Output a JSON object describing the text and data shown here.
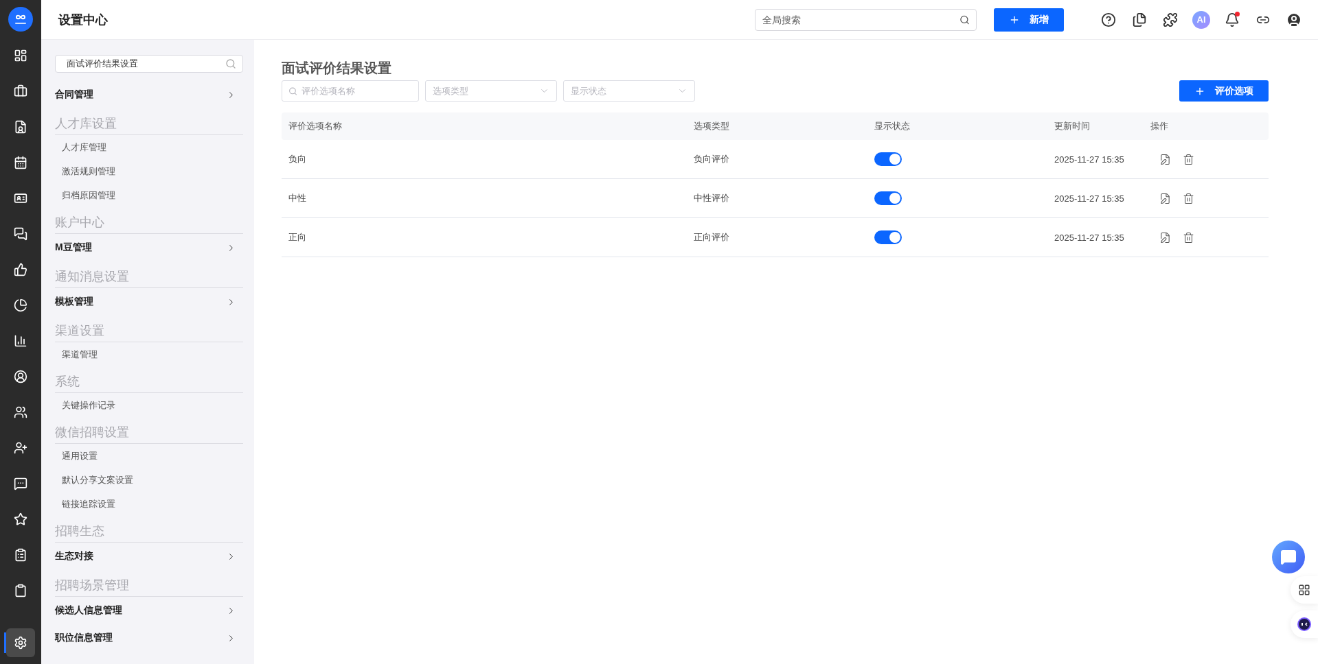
{
  "app": {
    "title": "设置中心"
  },
  "nav_rail": [
    {
      "selected": false
    },
    {
      "selected": false
    },
    {
      "selected": false
    },
    {
      "selected": false
    },
    {
      "selected": false
    },
    {
      "selected": false
    },
    {
      "selected": false
    },
    {
      "selected": false
    },
    {
      "selected": false
    },
    {
      "selected": false
    },
    {
      "selected": false
    },
    {
      "selected": false
    },
    {
      "selected": false
    },
    {
      "selected": false
    },
    {
      "selected": false
    },
    {
      "selected": false
    },
    {
      "selected": true
    }
  ],
  "top_bar": {
    "search": {
      "placeholder": "全局搜索"
    },
    "add_button": "新增",
    "ai_label": "AI",
    "notification_unread": true
  },
  "sidebar": {
    "search": {
      "value": "面试评价结果设置"
    },
    "sections": [
      {
        "items": [
          {
            "label": "合同管理",
            "kind": "link"
          }
        ]
      },
      {
        "heading": "人才库设置",
        "items": [
          {
            "label": "人才库管理",
            "kind": "sub"
          },
          {
            "label": "激活规则管理",
            "kind": "sub"
          },
          {
            "label": "归档原因管理",
            "kind": "sub"
          }
        ]
      },
      {
        "heading": "账户中心",
        "items": [
          {
            "label": "M豆管理",
            "kind": "link"
          }
        ]
      },
      {
        "heading": "通知消息设置",
        "items": [
          {
            "label": "模板管理",
            "kind": "link"
          }
        ]
      },
      {
        "heading": "渠道设置",
        "items": [
          {
            "label": "渠道管理",
            "kind": "sub"
          }
        ]
      },
      {
        "heading": "系统",
        "items": [
          {
            "label": "关键操作记录",
            "kind": "sub"
          }
        ]
      },
      {
        "heading": "微信招聘设置",
        "items": [
          {
            "label": "通用设置",
            "kind": "sub"
          },
          {
            "label": "默认分享文案设置",
            "kind": "sub"
          },
          {
            "label": "链接追踪设置",
            "kind": "sub"
          }
        ]
      },
      {
        "heading": "招聘生态",
        "items": [
          {
            "label": "生态对接",
            "kind": "link"
          }
        ]
      },
      {
        "heading": "招聘场景管理",
        "items": [
          {
            "label": "候选人信息管理",
            "kind": "link"
          },
          {
            "label": "职位信息管理",
            "kind": "link"
          }
        ]
      }
    ]
  },
  "page": {
    "title": "面试评价结果设置",
    "filters": {
      "name_search": {
        "placeholder": "评价选项名称"
      },
      "type_select": {
        "placeholder": "选项类型"
      },
      "status_select": {
        "placeholder": "显示状态"
      }
    },
    "add_button": "评价选项",
    "table": {
      "columns": [
        "评价选项名称",
        "选项类型",
        "显示状态",
        "更新时间",
        "操作"
      ],
      "rows": [
        {
          "name": "负向",
          "type": "负向评价",
          "on": true,
          "updated": "2025-11-27 15:35"
        },
        {
          "name": "中性",
          "type": "中性评价",
          "on": true,
          "updated": "2025-11-27 15:35"
        },
        {
          "name": "正向",
          "type": "正向评价",
          "on": true,
          "updated": "2025-11-27 15:35"
        }
      ]
    }
  }
}
